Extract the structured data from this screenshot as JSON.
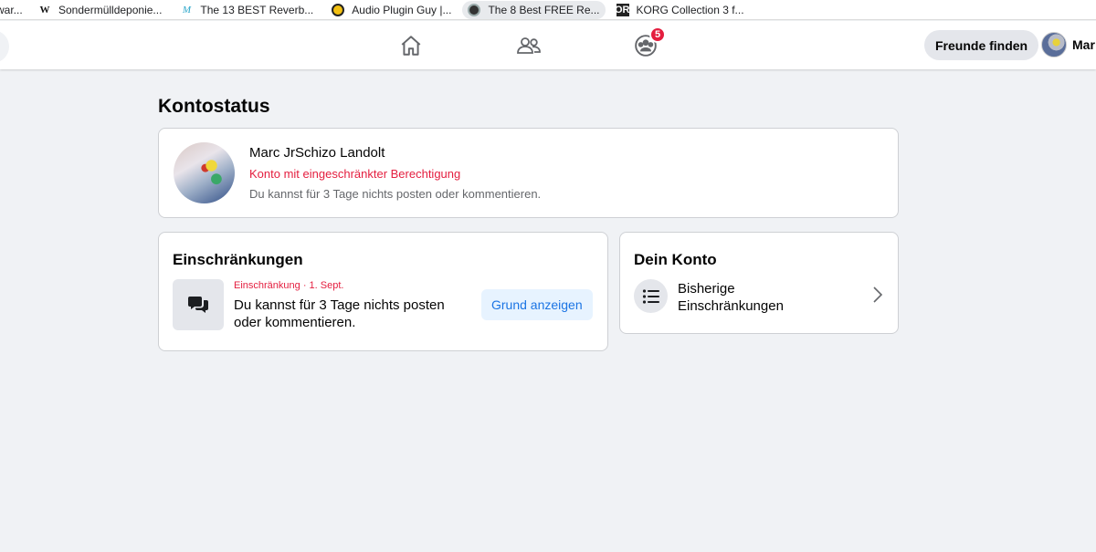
{
  "bookmarks": [
    {
      "label": "war...",
      "icon": "bookmark-partial-icon"
    },
    {
      "label": "Sondermülldeponie...",
      "icon": "wikipedia-icon"
    },
    {
      "label": "The 13 BEST Reverb...",
      "icon": "m-logo-icon"
    },
    {
      "label": "Audio Plugin Guy |...",
      "icon": "audio-plugin-guy-icon"
    },
    {
      "label": "The 8 Best FREE Re...",
      "icon": "dark-circle-icon"
    },
    {
      "label": "KORG Collection 3 f...",
      "icon": "korg-icon"
    }
  ],
  "nav": {
    "groups_badge": "5",
    "find_friends": "Freunde finden",
    "profile_name": "Mar"
  },
  "page": {
    "title": "Kontostatus"
  },
  "status": {
    "name": "Marc JrSchizo Landolt",
    "restricted": "Konto mit eingeschränkter Berechtigung",
    "description": "Du kannst für 3 Tage nichts posten oder kommentieren."
  },
  "restrictions": {
    "heading": "Einschränkungen",
    "meta": "Einschränkung · 1. Sept.",
    "text": "Du kannst für 3 Tage nichts posten oder kommentieren.",
    "button": "Grund anzeigen"
  },
  "account": {
    "heading": "Dein Konto",
    "item": "Bisherige Einschränkungen"
  },
  "colors": {
    "accent": "#1b74e4",
    "danger": "#e41e3f",
    "background": "#f0f2f5"
  }
}
